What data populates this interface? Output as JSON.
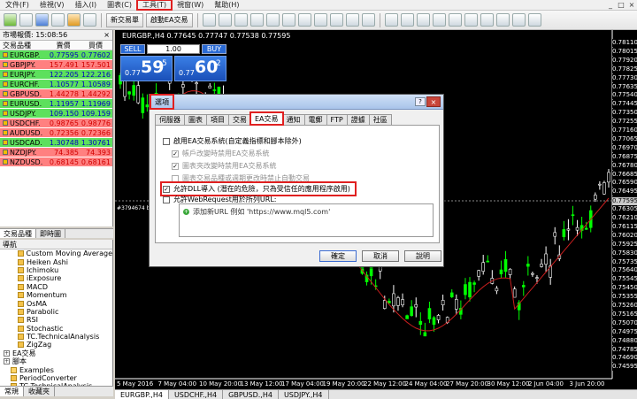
{
  "menubar": {
    "items": [
      "文件(F)",
      "檢視(V)",
      "插入(I)",
      "圖表(C)",
      "工具(T)",
      "視窗(W)",
      "幫助(H)"
    ],
    "highlighted_index": 4,
    "window_buttons": [
      "_",
      "□",
      "×"
    ]
  },
  "toolbar": {
    "new_order": "新交易單",
    "ea_trading": "啟動EA交易",
    "timeframes": [
      "M1",
      "M5",
      "M15",
      "M30",
      "H1",
      "H4",
      "D1",
      "W1",
      "MN"
    ]
  },
  "market_watch": {
    "title": "市場報價: 15:08:56",
    "close": "×",
    "columns": [
      "交易品種",
      "賣價",
      "買價"
    ],
    "rows": [
      {
        "symbol": "EURGBP.",
        "bid": "0.77595",
        "ask": "0.77602",
        "dir": "up"
      },
      {
        "symbol": "GBPJPY.",
        "bid": "157.491",
        "ask": "157.501",
        "dir": "dn"
      },
      {
        "symbol": "EURJPY.",
        "bid": "122.205",
        "ask": "122.216",
        "dir": "up"
      },
      {
        "symbol": "EURCHF.",
        "bid": "1.10577",
        "ask": "1.10589",
        "dir": "up"
      },
      {
        "symbol": "GBPUSD.",
        "bid": "1.44278",
        "ask": "1.44292",
        "dir": "dn"
      },
      {
        "symbol": "EURUSD.",
        "bid": "1.11957",
        "ask": "1.11969",
        "dir": "up"
      },
      {
        "symbol": "USDJPY.",
        "bid": "109.150",
        "ask": "109.159",
        "dir": "up"
      },
      {
        "symbol": "USDCHF.",
        "bid": "0.98765",
        "ask": "0.98776",
        "dir": "dn"
      },
      {
        "symbol": "AUDUSD.",
        "bid": "0.72356",
        "ask": "0.72366",
        "dir": "dn"
      },
      {
        "symbol": "USDCAD.",
        "bid": "1.30748",
        "ask": "1.30761",
        "dir": "up"
      },
      {
        "symbol": "NZDJPY.",
        "bid": "74.385",
        "ask": "74.393",
        "dir": "dn"
      },
      {
        "symbol": "NZDUSD.",
        "bid": "0.68145",
        "ask": "0.68161",
        "dir": "dn"
      }
    ],
    "tabs": [
      "交易品種",
      "即時圖"
    ]
  },
  "navigator": {
    "title": "導航",
    "items": [
      {
        "label": "Custom Moving Average",
        "indent": 2,
        "icon": "file"
      },
      {
        "label": "Heiken Ashi",
        "indent": 2,
        "icon": "file"
      },
      {
        "label": "Ichimoku",
        "indent": 2,
        "icon": "file"
      },
      {
        "label": "iExposure",
        "indent": 2,
        "icon": "file"
      },
      {
        "label": "MACD",
        "indent": 2,
        "icon": "file"
      },
      {
        "label": "Momentum",
        "indent": 2,
        "icon": "file"
      },
      {
        "label": "OsMA",
        "indent": 2,
        "icon": "file"
      },
      {
        "label": "Parabolic",
        "indent": 2,
        "icon": "file"
      },
      {
        "label": "RSI",
        "indent": 2,
        "icon": "file"
      },
      {
        "label": "Stochastic",
        "indent": 2,
        "icon": "file"
      },
      {
        "label": "TC.TechnicalAnalysis",
        "indent": 2,
        "icon": "file"
      },
      {
        "label": "ZigZag",
        "indent": 2,
        "icon": "file"
      },
      {
        "label": "EA交易",
        "indent": 0,
        "icon": "expand"
      },
      {
        "label": "腳本",
        "indent": 0,
        "icon": "expand"
      },
      {
        "label": "Examples",
        "indent": 1,
        "icon": "folder"
      },
      {
        "label": "PeriodConverter",
        "indent": 1,
        "icon": "file"
      },
      {
        "label": "TC.TechnicalAnalysis",
        "indent": 1,
        "icon": "file"
      }
    ],
    "tabs": [
      "常規",
      "收藏夾"
    ]
  },
  "chart": {
    "title": "EURGBP.,H4  0.77645 0.77747 0.77538 0.77595",
    "trade": {
      "sell": "SELL",
      "buy": "BUY",
      "lot": "1.00",
      "sell_small": "0.77",
      "sell_big": "59",
      "sell_sup": "5",
      "buy_small": "0.77",
      "buy_big": "60",
      "buy_sup": "2"
    },
    "order_label": "#3794674 bu",
    "price_labels": [
      "0.78110",
      "0.78015",
      "0.77920",
      "0.77825",
      "0.77730",
      "0.77635",
      "0.77540",
      "0.77445",
      "0.77350",
      "0.77255",
      "0.77160",
      "0.77065",
      "0.76970",
      "0.76875",
      "0.76780",
      "0.76685",
      "0.76590",
      "0.76495",
      "0.76400",
      "0.76305",
      "0.76210",
      "0.76115",
      "0.76020",
      "0.75925",
      "0.75830",
      "0.75735",
      "0.75640",
      "0.75545",
      "0.75450",
      "0.75355",
      "0.75260",
      "0.75165",
      "0.75070",
      "0.74975",
      "0.74880",
      "0.74785",
      "0.74690",
      "0.74595"
    ],
    "current_price": "0.77595",
    "date_labels": [
      "5 May 2016",
      "7 May 04:00",
      "10 May 20:00",
      "13 May 12:00",
      "17 May 04:00",
      "19 May 20:00",
      "22 May 12:00",
      "24 May 04:00",
      "27 May 20:00",
      "30 May 12:00",
      "2 Jun 04:00",
      "3 Jun 20:00"
    ],
    "tabs": [
      "EURGBP.,H4",
      "USDCHF.,H4",
      "GBPUSD.,H4",
      "USDJPY.,H4"
    ],
    "active_tab": 0
  },
  "dialog": {
    "title": "選項",
    "help": "?",
    "close": "×",
    "tabs": [
      "伺服器",
      "圖表",
      "項目",
      "交易",
      "EA交易",
      "通知",
      "電郵",
      "FTP",
      "證據",
      "社區"
    ],
    "active_tab": 4,
    "options": [
      {
        "label": "啟用EA交易系統(自定義指標和腳本除外)",
        "checked": false,
        "disabled": false
      },
      {
        "label": "帳戶改變時禁用EA交易系統",
        "checked": true,
        "disabled": true
      },
      {
        "label": "圖表夾改變時禁用EA交易系統",
        "checked": true,
        "disabled": true
      },
      {
        "label": "圖表交易品種或週期更改時禁止自動交易",
        "checked": false,
        "disabled": true
      },
      {
        "label": "允許DLL導入 (潛在的危險，只為受信任的應用程序啟用)",
        "checked": true,
        "disabled": false
      },
      {
        "label": "允許WebRequest用於所列URL:",
        "checked": false,
        "disabled": false
      }
    ],
    "url_add": "添加新URL 例如 'https://www.mql5.com'",
    "buttons": {
      "ok": "確定",
      "cancel": "取消",
      "help": "說明"
    }
  },
  "colors": {
    "highlight": "#e02020",
    "bull_candle": "#00ff00",
    "bear_candle": "#ffffff",
    "ma_line": "#c81e1e",
    "market_watch_up": "#00c800",
    "market_watch_down": "#e02020"
  }
}
